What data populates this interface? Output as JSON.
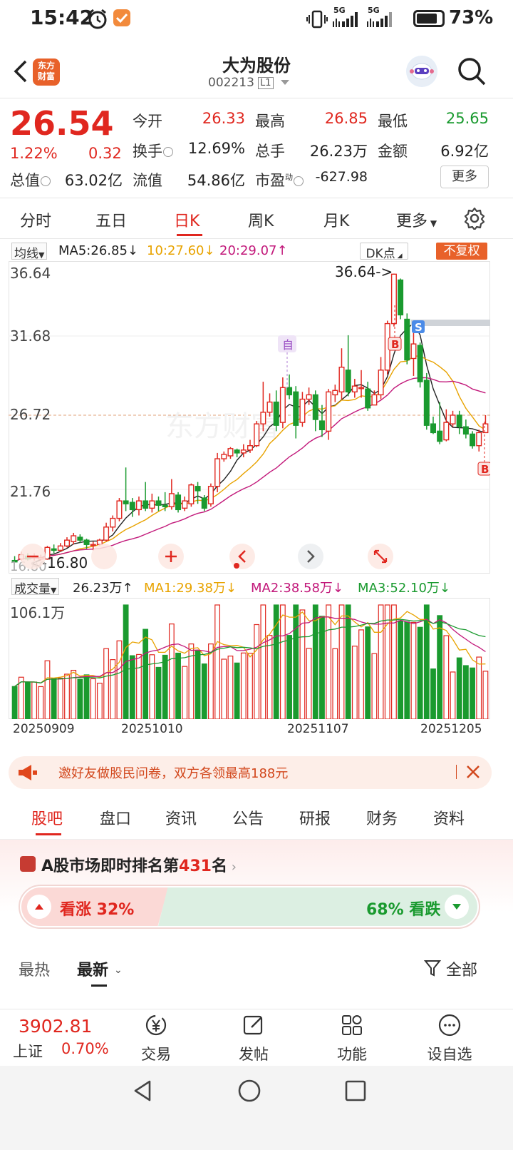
{
  "status_bar": {
    "time": "15:42",
    "signal_1": "5G",
    "signal_2": "5G",
    "battery": "73%",
    "battery_level": 0.73
  },
  "header": {
    "logo_text_1": "东方",
    "logo_text_2": "财富",
    "stock_name": "大为股份",
    "stock_code": "002213",
    "level": "L1"
  },
  "quote": {
    "price": "26.54",
    "change_pct": "1.22%",
    "change_abs": "0.32",
    "open_label": "今开",
    "open": "26.33",
    "high_label": "最高",
    "high": "26.85",
    "low_label": "最低",
    "low": "25.65",
    "turnover_label": "换手",
    "turnover": "12.69%",
    "volume_label": "总手",
    "volume": "26.23万",
    "amount_label": "金额",
    "amount": "6.92亿",
    "mktcap_label": "总值",
    "mktcap": "63.02亿",
    "float_label": "流值",
    "float": "54.86亿",
    "pe_label": "市盈",
    "pe_sup": "动",
    "pe": "-627.98",
    "more": "更多"
  },
  "period_tabs": [
    "分时",
    "五日",
    "日K",
    "周K",
    "月K",
    "更多"
  ],
  "ma_legend": {
    "selector": "均线",
    "ma5": "MA5:26.85↓",
    "ma10": "10:27.60↓",
    "ma20": "20:29.07↑",
    "dk": "DK点",
    "adjust": "不复权"
  },
  "kline": {
    "y_labels": [
      "36.64",
      "31.68",
      "26.72",
      "21.76"
    ],
    "high_annotation": "36.64->",
    "low_annotation": "<-16.80",
    "low_partial": "16.80",
    "marker_self": "自",
    "marker_s": "S",
    "marker_b": "B",
    "watermark": "东方财富"
  },
  "volume_legend": {
    "selector": "成交量",
    "vol": "26.23万↑",
    "ma1": "MA1:29.38万↓",
    "ma2": "MA2:38.58万↓",
    "ma3": "MA3:52.10万↓",
    "max_label": "106.1万"
  },
  "dates": [
    "20250909",
    "20251010",
    "20251107",
    "20251205"
  ],
  "promo": {
    "text": "邀好友做股民问卷，双方各领最高188元"
  },
  "section_tabs": [
    "股吧",
    "盘口",
    "资讯",
    "公告",
    "研报",
    "财务",
    "资料"
  ],
  "ranking": {
    "prefix": "A股市场即时排名第",
    "rank": "431",
    "suffix": "名"
  },
  "sentiment": {
    "bull": "看涨 32%",
    "bear": "68% 看跌",
    "bull_share": 0.32
  },
  "sort_tabs": {
    "hot": "最热",
    "new": "最新",
    "filter": "全部"
  },
  "bottom_nav": {
    "index_value": "3902.81",
    "index_name": "上证",
    "index_pct": "0.70%",
    "items": [
      "交易",
      "发帖",
      "功能",
      "设自选"
    ]
  },
  "colors": {
    "up": "#e0271f",
    "down": "#1a9a2f",
    "accent": "#e8612a"
  },
  "chart_data": {
    "type": "candlestick",
    "candles": [
      [
        16.9,
        16.8,
        17.2,
        16.8
      ],
      [
        17.0,
        17.3,
        17.5,
        16.9
      ],
      [
        17.2,
        17.0,
        17.4,
        16.9
      ],
      [
        17.1,
        17.2,
        17.4,
        16.9
      ],
      [
        17.0,
        17.1,
        17.3,
        16.9
      ],
      [
        17.0,
        17.8,
        17.9,
        16.95
      ],
      [
        17.7,
        17.6,
        18.0,
        17.4
      ],
      [
        17.6,
        17.9,
        18.1,
        17.5
      ],
      [
        17.9,
        18.3,
        18.5,
        17.8
      ],
      [
        18.2,
        18.6,
        18.8,
        18.0
      ],
      [
        18.5,
        18.3,
        18.7,
        18.1
      ],
      [
        18.3,
        18.0,
        18.4,
        17.7
      ],
      [
        18.0,
        18.0,
        18.2,
        17.6
      ],
      [
        18.0,
        18.3,
        18.4,
        17.9
      ],
      [
        18.3,
        19.2,
        19.5,
        18.2
      ],
      [
        19.2,
        19.8,
        20.0,
        18.9
      ],
      [
        19.8,
        21.0,
        21.2,
        19.6
      ],
      [
        21.0,
        20.8,
        23.3,
        20.3
      ],
      [
        20.9,
        20.4,
        21.2,
        19.9
      ],
      [
        20.4,
        21.0,
        21.3,
        20.0
      ],
      [
        21.0,
        20.5,
        22.3,
        20.3
      ],
      [
        20.5,
        21.0,
        21.5,
        20.2
      ],
      [
        21.0,
        20.7,
        21.3,
        20.3
      ],
      [
        20.7,
        20.6,
        21.6,
        20.3
      ],
      [
        20.6,
        21.5,
        22.5,
        20.4
      ],
      [
        21.4,
        20.4,
        21.6,
        20.2
      ],
      [
        20.5,
        21.0,
        21.3,
        20.3
      ],
      [
        20.8,
        22.1,
        22.2,
        20.6
      ],
      [
        22.0,
        21.7,
        22.3,
        20.8
      ],
      [
        21.2,
        20.5,
        21.4,
        20.3
      ],
      [
        20.8,
        22.0,
        22.2,
        20.6
      ],
      [
        22.0,
        23.9,
        24.3,
        21.6
      ],
      [
        23.9,
        24.2,
        24.4,
        23.7
      ],
      [
        24.1,
        24.6,
        24.7,
        23.9
      ],
      [
        24.5,
        24.3,
        24.6,
        24.0
      ],
      [
        24.3,
        24.5,
        24.9,
        24.0
      ],
      [
        24.5,
        24.8,
        25.2,
        24.3
      ],
      [
        24.8,
        26.3,
        26.5,
        24.7
      ],
      [
        26.3,
        27.1,
        29.2,
        25.8
      ],
      [
        27.1,
        27.8,
        28.4,
        26.8
      ],
      [
        27.8,
        26.2,
        28.6,
        25.8
      ],
      [
        26.4,
        28.8,
        29.5,
        26.0
      ],
      [
        28.8,
        28.3,
        29.7,
        28.0
      ],
      [
        28.5,
        26.2,
        28.9,
        25.3
      ],
      [
        26.4,
        28.0,
        28.5,
        26.1
      ],
      [
        28.0,
        28.3,
        28.8,
        27.6
      ],
      [
        28.3,
        26.6,
        28.6,
        25.8
      ],
      [
        26.5,
        25.9,
        27.6,
        25.4
      ],
      [
        25.8,
        28.5,
        28.7,
        25.2
      ],
      [
        28.3,
        28.6,
        29.0,
        27.8
      ],
      [
        28.5,
        30.2,
        31.5,
        28.0
      ],
      [
        30.0,
        28.5,
        32.4,
        28.2
      ],
      [
        28.5,
        28.9,
        29.4,
        28.1
      ],
      [
        28.8,
        28.8,
        30.0,
        28.1
      ],
      [
        28.7,
        27.4,
        29.2,
        27.2
      ],
      [
        27.6,
        28.3,
        28.6,
        27.6
      ],
      [
        28.3,
        30.0,
        30.9,
        28.0
      ],
      [
        30.0,
        33.2,
        33.4,
        29.7
      ],
      [
        33.2,
        36.6,
        36.64,
        33.0
      ],
      [
        36.2,
        33.8,
        36.3,
        33.5
      ],
      [
        33.5,
        30.7,
        33.9,
        30.4
      ],
      [
        30.8,
        31.8,
        32.8,
        29.6
      ],
      [
        31.7,
        29.2,
        31.9,
        28.8
      ],
      [
        29.3,
        26.2,
        29.8,
        25.9
      ],
      [
        26.3,
        25.7,
        26.8,
        25.6
      ],
      [
        25.8,
        25.1,
        27.8,
        24.9
      ],
      [
        25.2,
        26.4,
        27.3,
        25.1
      ],
      [
        26.3,
        26.9,
        27.2,
        26.1
      ],
      [
        26.9,
        26.1,
        27.2,
        25.6
      ],
      [
        26.1,
        25.6,
        26.6,
        25.3
      ],
      [
        25.6,
        24.8,
        25.8,
        24.6
      ],
      [
        24.8,
        25.7,
        25.9,
        24.4
      ],
      [
        25.7,
        26.3,
        26.9,
        25.8
      ]
    ],
    "y_range": [
      16.0,
      37.5
    ],
    "volume_max": "106.1万"
  }
}
